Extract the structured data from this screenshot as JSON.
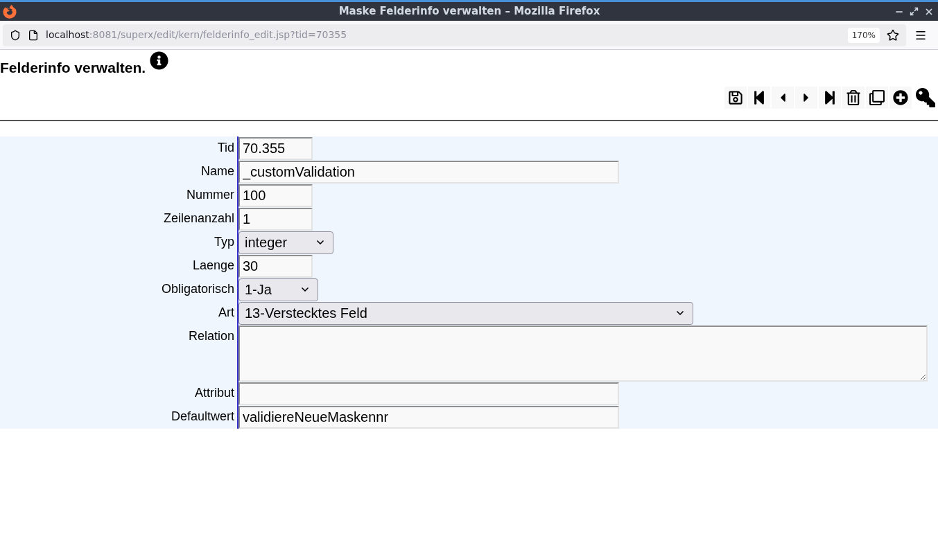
{
  "window": {
    "title": "Maske Felderinfo verwalten – Mozilla Firefox"
  },
  "address_bar": {
    "host": "localhost",
    "path": ":8081/superx/edit/kern/felderinfo_edit.jsp?tid=70355",
    "zoom": "170%"
  },
  "page": {
    "heading": "Felderinfo verwalten."
  },
  "form": {
    "fields": [
      {
        "label": "Tid",
        "kind": "short",
        "value": "70.355"
      },
      {
        "label": "Name",
        "kind": "long",
        "value": "_customValidation"
      },
      {
        "label": "Nummer",
        "kind": "short",
        "value": "100"
      },
      {
        "label": "Zeilenanzahl",
        "kind": "short",
        "value": "1"
      },
      {
        "label": "Typ",
        "kind": "select",
        "value": "integer"
      },
      {
        "label": "Laenge",
        "kind": "short",
        "value": "30"
      },
      {
        "label": "Obligatorisch",
        "kind": "select",
        "value": "1-Ja"
      },
      {
        "label": "Art",
        "kind": "wide-select",
        "value": "13-Verstecktes Feld"
      },
      {
        "label": "Relation",
        "kind": "textarea"
      },
      {
        "label": "Attribut",
        "kind": "long"
      },
      {
        "label": "Defaultwert",
        "kind": "long",
        "value": "validiereNeueMaskennr"
      }
    ]
  }
}
